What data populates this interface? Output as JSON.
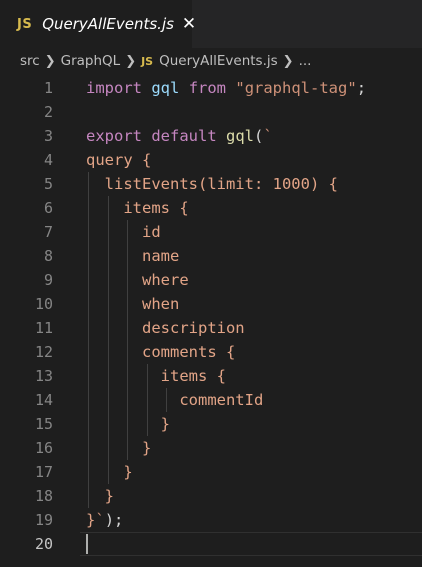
{
  "tab": {
    "badge": "JS",
    "title": "QueryAllEvents.js",
    "close": "✕"
  },
  "breadcrumb": {
    "items": [
      "src",
      "GraphQL",
      "QueryAllEvents.js",
      "..."
    ],
    "js_badge": "JS"
  },
  "editor": {
    "current_line": 20,
    "lines": [
      {
        "n": "1",
        "text": "import gql from \"graphql-tag\";"
      },
      {
        "n": "2",
        "text": ""
      },
      {
        "n": "3",
        "text": "export default gql(`"
      },
      {
        "n": "4",
        "text": "query {"
      },
      {
        "n": "5",
        "text": "  listEvents(limit: 1000) {"
      },
      {
        "n": "6",
        "text": "    items {"
      },
      {
        "n": "7",
        "text": "      id"
      },
      {
        "n": "8",
        "text": "      name"
      },
      {
        "n": "9",
        "text": "      where"
      },
      {
        "n": "10",
        "text": "      when"
      },
      {
        "n": "11",
        "text": "      description"
      },
      {
        "n": "12",
        "text": "      comments {"
      },
      {
        "n": "13",
        "text": "        items {"
      },
      {
        "n": "14",
        "text": "          commentId"
      },
      {
        "n": "15",
        "text": "        }"
      },
      {
        "n": "16",
        "text": "      }"
      },
      {
        "n": "17",
        "text": "    }"
      },
      {
        "n": "18",
        "text": "  }"
      },
      {
        "n": "19",
        "text": "}`);"
      },
      {
        "n": "20",
        "text": ""
      }
    ]
  },
  "colors": {
    "background": "#1e1e1e",
    "keyword": "#c586c0",
    "function": "#dcdcaa",
    "string": "#ce9178",
    "variable": "#9cdcfe",
    "graphql": "#e2a487",
    "line_number": "#858585"
  }
}
